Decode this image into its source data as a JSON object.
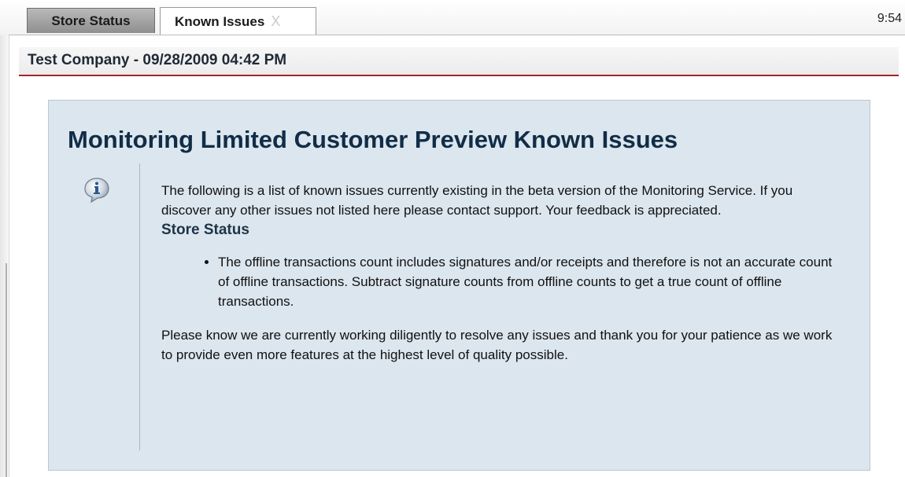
{
  "tabs": [
    {
      "label": "Store Status",
      "active": false
    },
    {
      "label": "Known Issues",
      "active": true,
      "close": "X"
    }
  ],
  "clock": "9:54",
  "header": {
    "title": "Test Company - 09/28/2009 04:42 PM"
  },
  "panel": {
    "title": "Monitoring Limited Customer Preview Known Issues",
    "icon": "info-speech-bubble-icon",
    "intro": "The following is a list of known issues currently existing in the beta version of the Monitoring Service. If you discover any other issues not listed here please contact support. Your feedback is appreciated.",
    "section_heading": "Store Status",
    "bullets": [
      "The offline transactions count includes signatures and/or receipts and therefore is not an accurate count of offline transactions. Subtract signature counts from offline counts to get a true count of offline transactions."
    ],
    "closing": "Please know we are currently working diligently to resolve any issues and thank you for your patience as we work to provide even more features at the highest level of quality possible."
  },
  "colors": {
    "accent_rule": "#a5252e",
    "panel_bg": "#dce6ee",
    "title_color": "#112d47"
  }
}
